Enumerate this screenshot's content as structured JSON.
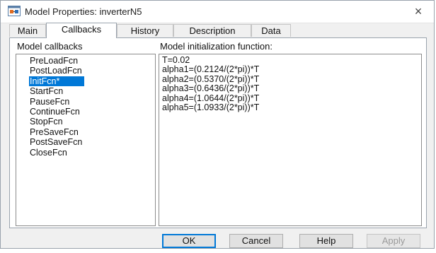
{
  "window": {
    "title": "Model Properties: inverterN5",
    "close_glyph": "×"
  },
  "tabs": [
    {
      "label": "Main"
    },
    {
      "label": "Callbacks",
      "active": true
    },
    {
      "label": "History"
    },
    {
      "label": "Description"
    },
    {
      "label": "Data"
    }
  ],
  "callbacks": {
    "header": "Model callbacks",
    "items": [
      "PreLoadFcn",
      "PostLoadFcn",
      "InitFcn*",
      "StartFcn",
      "PauseFcn",
      "ContinueFcn",
      "StopFcn",
      "PreSaveFcn",
      "PostSaveFcn",
      "CloseFcn"
    ],
    "selected": "InitFcn*"
  },
  "editor": {
    "header": "Model initialization function:",
    "lines": [
      "T=0.02",
      "alpha1=(0.2124/(2*pi))*T",
      "alpha2=(0.5370/(2*pi))*T",
      "alpha3=(0.6436/(2*pi))*T",
      "alpha4=(1.0644/(2*pi))*T",
      "alpha5=(1.0933/(2*pi))*T"
    ]
  },
  "buttons": {
    "ok": "OK",
    "cancel": "Cancel",
    "help": "Help",
    "apply": "Apply"
  },
  "colors": {
    "selection": "#0078d7",
    "window_bg": "#f0f0f0"
  }
}
